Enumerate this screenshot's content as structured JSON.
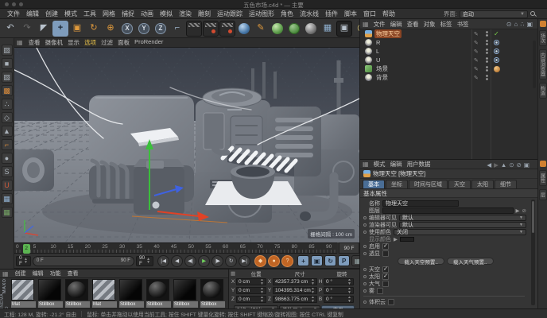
{
  "window": {
    "title": "五色市场.c4d * — 主要"
  },
  "menubar": {
    "items": [
      "文件",
      "编辑",
      "创建",
      "模式",
      "工具",
      "网格",
      "捕捉",
      "动画",
      "模拟",
      "渲染",
      "雕刻",
      "运动跟踪",
      "运动图形",
      "角色",
      "流水线",
      "插件",
      "脚本",
      "窗口",
      "帮助"
    ],
    "interface_label": "界面:",
    "interface_value": "启动"
  },
  "toolbar": {
    "items": [
      {
        "name": "undo",
        "glyph": "↶"
      },
      {
        "name": "redo",
        "glyph": "↷",
        "dim": true
      },
      {
        "name": "live-selection",
        "glyph": "◤"
      },
      {
        "name": "move-tool",
        "glyph": "+",
        "active": true
      },
      {
        "name": "scale-tool",
        "glyph": "▣",
        "color": "#e09a3c"
      },
      {
        "name": "rotate-tool",
        "glyph": "↻",
        "color": "#e09a3c"
      },
      {
        "name": "last-tool",
        "glyph": "⊕",
        "color": "#e09a3c"
      },
      {
        "name": "lock-x-axis",
        "glyph": "X",
        "circle": true
      },
      {
        "name": "lock-y-axis",
        "glyph": "Y",
        "circle": true
      },
      {
        "name": "lock-z-axis",
        "glyph": "Z",
        "circle": true
      },
      {
        "name": "coord-system",
        "glyph": "⌐",
        "color": "#9ab0c6"
      },
      {
        "name": "render-view",
        "clapper": true
      },
      {
        "name": "render-marked",
        "clapper": true,
        "dot": true
      },
      {
        "name": "render-team",
        "clapper": true,
        "dot": true
      },
      {
        "name": "render-settings",
        "sphere": "blue"
      },
      {
        "name": "spline-pen",
        "glyph": "✎",
        "color": "#e09a3c"
      },
      {
        "name": "subdivision-surface",
        "sphere": "green"
      },
      {
        "name": "deformer",
        "sphere": "greenwire"
      },
      {
        "name": "volume",
        "sphere": "gray"
      },
      {
        "name": "floor-object",
        "glyph": "▦",
        "color": "#8fb0d0"
      },
      {
        "name": "camera-object",
        "glyph": "▣",
        "pressed": true
      },
      {
        "name": "light-object",
        "glyph": "◎",
        "color": "#e6d27a"
      }
    ],
    "nav_items": [
      {
        "name": "pan-view",
        "glyph": "⊕"
      },
      {
        "name": "home-view",
        "glyph": "⌂"
      },
      {
        "name": "rotate-view",
        "glyph": "↻"
      },
      {
        "name": "toggle-views",
        "glyph": "▦"
      }
    ]
  },
  "modebar": {
    "items": [
      {
        "name": "make-editable",
        "glyph": "▨"
      },
      {
        "name": "model-mode",
        "glyph": "■"
      },
      {
        "name": "texture-axes-mode",
        "glyph": "▧"
      },
      {
        "name": "texture-mode",
        "glyph": "▩",
        "color": "#d98a3a"
      },
      {
        "name": "point-mode",
        "glyph": "∴"
      },
      {
        "name": "edge-mode",
        "glyph": "◇"
      },
      {
        "name": "polygon-mode",
        "glyph": "▲"
      },
      {
        "name": "axis-mode",
        "glyph": "⌐",
        "color": "#d98a3a"
      },
      {
        "name": "solo-mode",
        "glyph": "●"
      },
      {
        "name": "snap-toggle",
        "glyph": "S"
      },
      {
        "name": "magnet-snap",
        "glyph": "U",
        "color": "#d05a3a"
      },
      {
        "name": "workplane-lock",
        "glyph": "▦",
        "color": "#8fb0d0"
      },
      {
        "name": "workplane-mode",
        "glyph": "▦",
        "color": "#74a464"
      }
    ]
  },
  "viewport": {
    "menus": [
      {
        "label": "查看"
      },
      {
        "label": "摄像机"
      },
      {
        "label": "显示"
      },
      {
        "label": "选项",
        "active": true
      },
      {
        "label": "过滤"
      },
      {
        "label": "面板"
      },
      {
        "label": "ProRender"
      }
    ],
    "scale_label": "栅格间隔 : 100 cm"
  },
  "object_manager": {
    "menus": [
      "文件",
      "编辑",
      "查看",
      "对象",
      "标签",
      "书签"
    ],
    "objects": [
      {
        "name": "物理天空",
        "icon": "sky",
        "selected": true,
        "tags": [
          "check"
        ]
      },
      {
        "name": "R",
        "icon": "light",
        "tags": [
          "target"
        ]
      },
      {
        "name": "L",
        "icon": "light",
        "tags": [
          "target"
        ]
      },
      {
        "name": "U",
        "icon": "light",
        "tags": [
          "target"
        ]
      },
      {
        "name": "场景",
        "icon": "green",
        "tags": [
          "material"
        ]
      },
      {
        "name": "背景",
        "icon": "light",
        "tags": []
      }
    ]
  },
  "right_tabs": {
    "top": [
      "场次",
      "内容浏览器",
      "构造"
    ],
    "bottom": [
      "属性",
      "层"
    ]
  },
  "attribute_manager": {
    "menus": [
      "模式",
      "编辑",
      "用户数据"
    ],
    "title": "物理天空 [物理天空]",
    "tabs": [
      "基本",
      "坐标",
      "时间与区域",
      "天空",
      "太阳",
      "细节"
    ],
    "active_tab": "基本",
    "section": "基本属性",
    "rows": [
      {
        "type": "input",
        "label": "名称",
        "value": "物理天空"
      },
      {
        "type": "layer",
        "label": "图层",
        "value": ""
      },
      {
        "type": "dropdown",
        "label": "编辑器可见",
        "value": "默认",
        "dot": true
      },
      {
        "type": "dropdown",
        "label": "渲染器可见",
        "value": "默认",
        "dot": true
      },
      {
        "type": "dropdown",
        "label": "使用颜色",
        "value": "关闭",
        "dot": true
      },
      {
        "type": "color",
        "label": "显示颜色"
      },
      {
        "type": "check",
        "label": "启用",
        "checked": true,
        "dot": true
      },
      {
        "type": "check",
        "label": "透显",
        "checked": false,
        "dot": true
      },
      {
        "type": "buttons",
        "labels": [
          "载入天空预置..",
          "载入天气预置.."
        ]
      },
      {
        "type": "check",
        "label": "天空",
        "checked": true,
        "dot": true
      },
      {
        "type": "check",
        "label": "太阳",
        "checked": true,
        "dot": true
      },
      {
        "type": "check",
        "label": "大气",
        "checked": false,
        "dot": true
      },
      {
        "type": "check",
        "label": "雾",
        "checked": false,
        "dot": true
      },
      {
        "type": "divider"
      },
      {
        "type": "check",
        "label": "体积云",
        "checked": false,
        "dot": true
      }
    ]
  },
  "coordinates": {
    "headers": [
      "位置",
      "尺寸",
      "旋转"
    ],
    "position": {
      "x_label": "X",
      "x": "0 cm",
      "y_label": "Y",
      "y": "0 cm",
      "z_label": "Z",
      "z": "0 cm"
    },
    "size": {
      "x": "42357.373 cm",
      "y": "104395.314 cm",
      "z": "98663.775 cm"
    },
    "rotation": {
      "h_label": "H",
      "h": "0 °",
      "p_label": "P",
      "p": "0 °",
      "b_label": "B",
      "b": "0 °"
    },
    "mode_dropdown": "对象 (相对)",
    "size_dropdown": "单独尺寸",
    "apply_label": "应用"
  },
  "timeline": {
    "start": 0,
    "end": 90,
    "label_step": 5,
    "playhead": 2,
    "playhead_label": "2",
    "frame_start": "0 F",
    "frame_end": "90 F",
    "current": "90 F"
  },
  "transport": {
    "buttons": [
      {
        "name": "goto-start",
        "glyph": "|◀"
      },
      {
        "name": "play-backwards",
        "glyph": "◀"
      },
      {
        "name": "prev-frame",
        "glyph": "◀|"
      },
      {
        "name": "play-forwards",
        "glyph": "▶",
        "green": true
      },
      {
        "name": "next-frame",
        "glyph": "|▶"
      },
      {
        "name": "play-loop",
        "glyph": "↻"
      },
      {
        "name": "goto-end",
        "glyph": "▶|"
      }
    ],
    "record_buttons": [
      {
        "name": "record-keyframe",
        "glyph": "◆"
      },
      {
        "name": "autokey-toggle",
        "glyph": "●"
      },
      {
        "name": "keyframe-selection",
        "glyph": "?"
      }
    ],
    "toggle_buttons": [
      {
        "name": "record-position",
        "glyph": "+",
        "on": true
      },
      {
        "name": "record-scale",
        "glyph": "▣",
        "on": true
      },
      {
        "name": "record-rotation",
        "glyph": "↻",
        "on": true
      },
      {
        "name": "record-parameter",
        "glyph": "P",
        "on": true
      },
      {
        "name": "record-pla",
        "glyph": "▦",
        "on": false
      }
    ],
    "solo_button": {
      "name": "animation-solo",
      "glyph": "◉"
    }
  },
  "materials": {
    "menus": [
      "创建",
      "编辑",
      "功能",
      "查看"
    ],
    "brand_top": "MAXON",
    "brand_bottom": "CINEMA 4D",
    "items": [
      {
        "label": "Mat",
        "style": "stripes"
      },
      {
        "label": "Stillbox",
        "style": "black"
      },
      {
        "label": "Stillbox",
        "style": "sphere"
      },
      {
        "label": "Mat",
        "style": "stripes"
      },
      {
        "label": "Stillbox",
        "style": "black"
      },
      {
        "label": "Stillbox",
        "style": "sphere"
      },
      {
        "label": "Stillbox",
        "style": "black"
      },
      {
        "label": "Stillbox",
        "style": "sphere"
      }
    ]
  },
  "status": {
    "info": "工程: 128 M, 旋转: -21.2° 自由",
    "hint": "鼠标: 单击并拖动以使用当前工具; 按住 SHIFT 键量化旋转; 按住 SHIFT 键缩放/旋转视图; 按住 CTRL 键复制"
  }
}
